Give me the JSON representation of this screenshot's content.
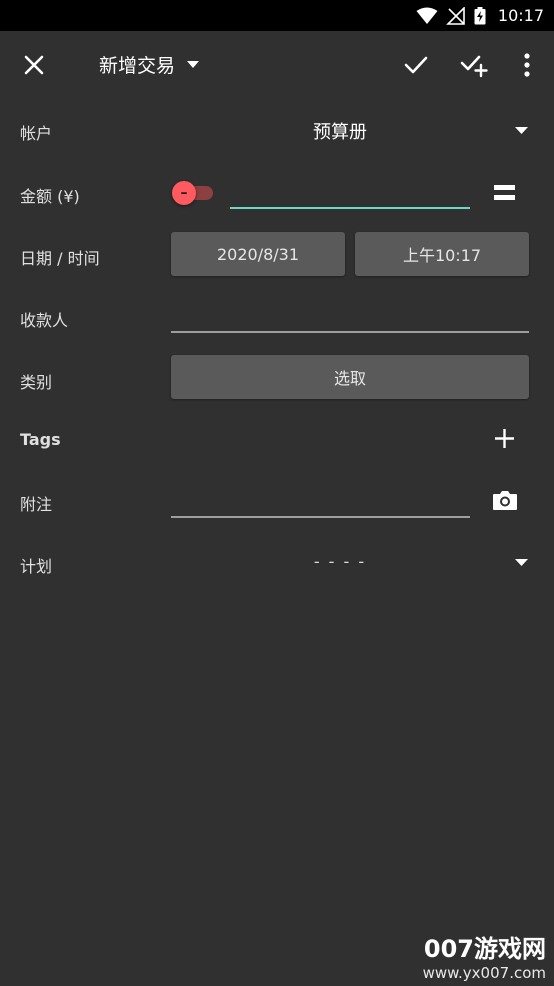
{
  "status_bar": {
    "time": "10:17"
  },
  "toolbar": {
    "title": "新增交易"
  },
  "form": {
    "account": {
      "label": "帐户",
      "value": "预算册"
    },
    "amount": {
      "label": "金额 (¥)",
      "sign": "–",
      "value": ""
    },
    "datetime": {
      "label": "日期 / 时间",
      "date": "2020/8/31",
      "time": "上午10:17"
    },
    "payee": {
      "label": "收款人",
      "value": ""
    },
    "category": {
      "label": "类别",
      "button": "选取"
    },
    "tags": {
      "label": "Tags"
    },
    "notes": {
      "label": "附注",
      "value": ""
    },
    "plan": {
      "label": "计划",
      "value": "- - - -"
    }
  },
  "watermark": {
    "line1": "007游戏网",
    "line2": "www.yx007.com"
  },
  "colors": {
    "background": "#303030",
    "accent_underline": "#6fd6c3",
    "toggle_thumb": "#ff5a5f",
    "button_bg": "#5a5a5a"
  }
}
